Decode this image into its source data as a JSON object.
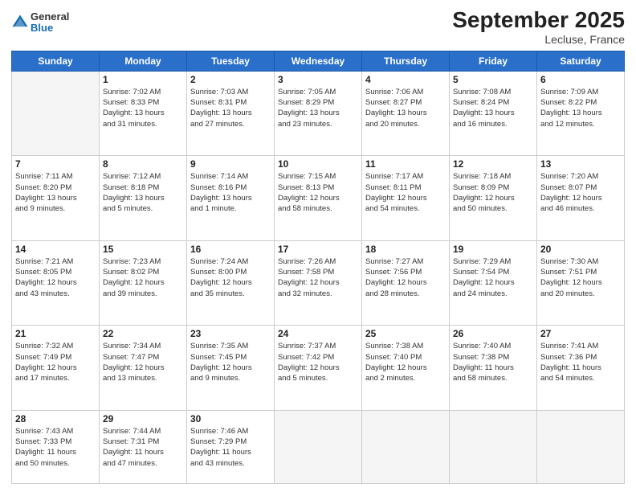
{
  "header": {
    "logo": {
      "general": "General",
      "blue": "Blue"
    },
    "title": "September 2025",
    "subtitle": "Lecluse, France"
  },
  "columns": [
    "Sunday",
    "Monday",
    "Tuesday",
    "Wednesday",
    "Thursday",
    "Friday",
    "Saturday"
  ],
  "weeks": [
    [
      {
        "day": "",
        "info": ""
      },
      {
        "day": "1",
        "info": "Sunrise: 7:02 AM\nSunset: 8:33 PM\nDaylight: 13 hours\nand 31 minutes."
      },
      {
        "day": "2",
        "info": "Sunrise: 7:03 AM\nSunset: 8:31 PM\nDaylight: 13 hours\nand 27 minutes."
      },
      {
        "day": "3",
        "info": "Sunrise: 7:05 AM\nSunset: 8:29 PM\nDaylight: 13 hours\nand 23 minutes."
      },
      {
        "day": "4",
        "info": "Sunrise: 7:06 AM\nSunset: 8:27 PM\nDaylight: 13 hours\nand 20 minutes."
      },
      {
        "day": "5",
        "info": "Sunrise: 7:08 AM\nSunset: 8:24 PM\nDaylight: 13 hours\nand 16 minutes."
      },
      {
        "day": "6",
        "info": "Sunrise: 7:09 AM\nSunset: 8:22 PM\nDaylight: 13 hours\nand 12 minutes."
      }
    ],
    [
      {
        "day": "7",
        "info": "Sunrise: 7:11 AM\nSunset: 8:20 PM\nDaylight: 13 hours\nand 9 minutes."
      },
      {
        "day": "8",
        "info": "Sunrise: 7:12 AM\nSunset: 8:18 PM\nDaylight: 13 hours\nand 5 minutes."
      },
      {
        "day": "9",
        "info": "Sunrise: 7:14 AM\nSunset: 8:16 PM\nDaylight: 13 hours\nand 1 minute."
      },
      {
        "day": "10",
        "info": "Sunrise: 7:15 AM\nSunset: 8:13 PM\nDaylight: 12 hours\nand 58 minutes."
      },
      {
        "day": "11",
        "info": "Sunrise: 7:17 AM\nSunset: 8:11 PM\nDaylight: 12 hours\nand 54 minutes."
      },
      {
        "day": "12",
        "info": "Sunrise: 7:18 AM\nSunset: 8:09 PM\nDaylight: 12 hours\nand 50 minutes."
      },
      {
        "day": "13",
        "info": "Sunrise: 7:20 AM\nSunset: 8:07 PM\nDaylight: 12 hours\nand 46 minutes."
      }
    ],
    [
      {
        "day": "14",
        "info": "Sunrise: 7:21 AM\nSunset: 8:05 PM\nDaylight: 12 hours\nand 43 minutes."
      },
      {
        "day": "15",
        "info": "Sunrise: 7:23 AM\nSunset: 8:02 PM\nDaylight: 12 hours\nand 39 minutes."
      },
      {
        "day": "16",
        "info": "Sunrise: 7:24 AM\nSunset: 8:00 PM\nDaylight: 12 hours\nand 35 minutes."
      },
      {
        "day": "17",
        "info": "Sunrise: 7:26 AM\nSunset: 7:58 PM\nDaylight: 12 hours\nand 32 minutes."
      },
      {
        "day": "18",
        "info": "Sunrise: 7:27 AM\nSunset: 7:56 PM\nDaylight: 12 hours\nand 28 minutes."
      },
      {
        "day": "19",
        "info": "Sunrise: 7:29 AM\nSunset: 7:54 PM\nDaylight: 12 hours\nand 24 minutes."
      },
      {
        "day": "20",
        "info": "Sunrise: 7:30 AM\nSunset: 7:51 PM\nDaylight: 12 hours\nand 20 minutes."
      }
    ],
    [
      {
        "day": "21",
        "info": "Sunrise: 7:32 AM\nSunset: 7:49 PM\nDaylight: 12 hours\nand 17 minutes."
      },
      {
        "day": "22",
        "info": "Sunrise: 7:34 AM\nSunset: 7:47 PM\nDaylight: 12 hours\nand 13 minutes."
      },
      {
        "day": "23",
        "info": "Sunrise: 7:35 AM\nSunset: 7:45 PM\nDaylight: 12 hours\nand 9 minutes."
      },
      {
        "day": "24",
        "info": "Sunrise: 7:37 AM\nSunset: 7:42 PM\nDaylight: 12 hours\nand 5 minutes."
      },
      {
        "day": "25",
        "info": "Sunrise: 7:38 AM\nSunset: 7:40 PM\nDaylight: 12 hours\nand 2 minutes."
      },
      {
        "day": "26",
        "info": "Sunrise: 7:40 AM\nSunset: 7:38 PM\nDaylight: 11 hours\nand 58 minutes."
      },
      {
        "day": "27",
        "info": "Sunrise: 7:41 AM\nSunset: 7:36 PM\nDaylight: 11 hours\nand 54 minutes."
      }
    ],
    [
      {
        "day": "28",
        "info": "Sunrise: 7:43 AM\nSunset: 7:33 PM\nDaylight: 11 hours\nand 50 minutes."
      },
      {
        "day": "29",
        "info": "Sunrise: 7:44 AM\nSunset: 7:31 PM\nDaylight: 11 hours\nand 47 minutes."
      },
      {
        "day": "30",
        "info": "Sunrise: 7:46 AM\nSunset: 7:29 PM\nDaylight: 11 hours\nand 43 minutes."
      },
      {
        "day": "",
        "info": ""
      },
      {
        "day": "",
        "info": ""
      },
      {
        "day": "",
        "info": ""
      },
      {
        "day": "",
        "info": ""
      }
    ]
  ]
}
